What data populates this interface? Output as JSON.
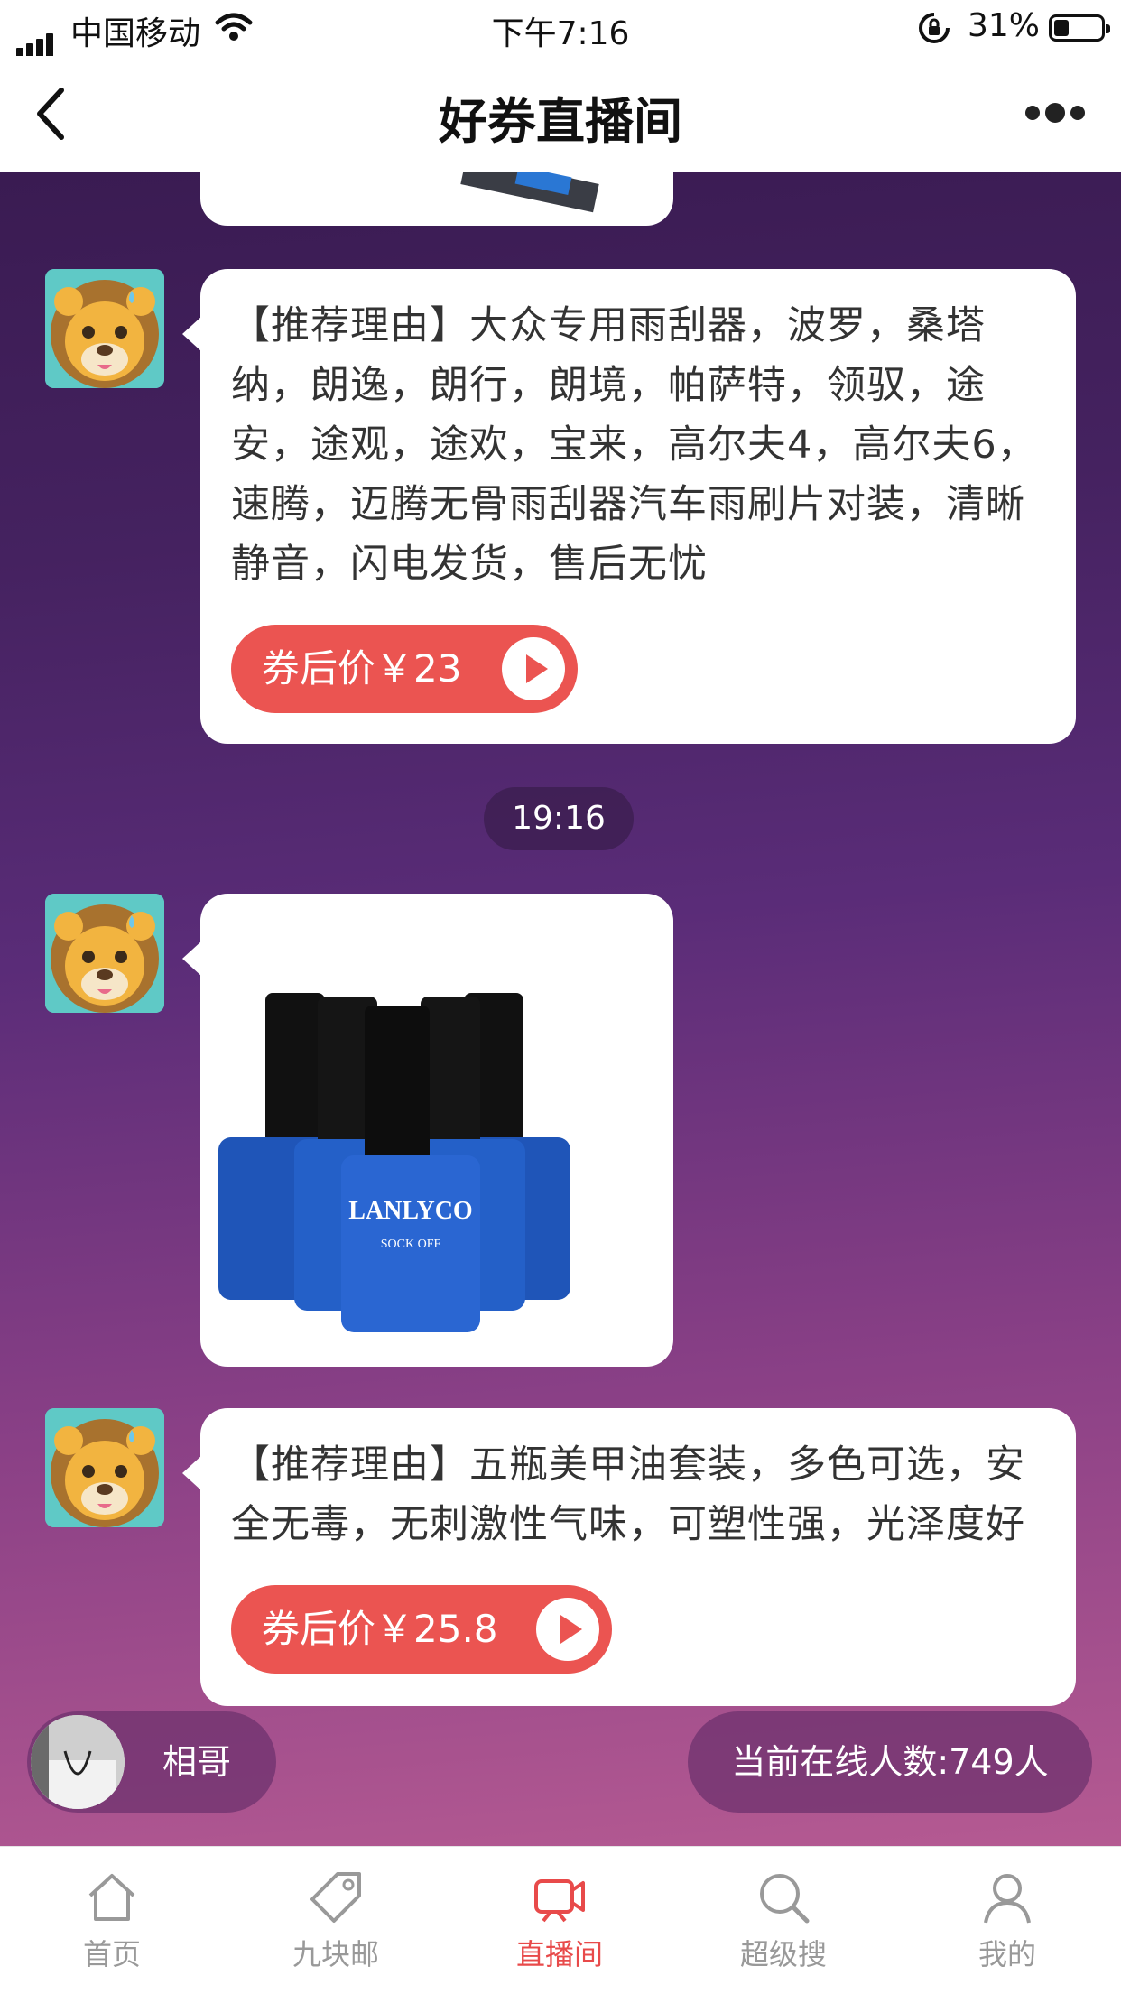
{
  "status_bar": {
    "carrier": "中国移动",
    "time": "下午7:16",
    "battery_pct": "31%",
    "battery_level": 0.31
  },
  "nav": {
    "title": "好券直播间"
  },
  "messages": [
    {
      "type": "text",
      "text": "【推荐理由】大众专用雨刮器，波罗，桑塔纳，朗逸，朗行，朗境，帕萨特，领驭，途安，途观，途欢，宝来，高尔夫4，高尔夫6，速腾，迈腾无骨雨刮器汽车雨刷片对装，清晰静音，闪电发货，售后无忧",
      "price_label": "券后价￥23"
    },
    {
      "type": "timestamp",
      "text": "19:16"
    },
    {
      "type": "image",
      "product_brand": "LANLYCO",
      "product_sub": "SOCK OFF"
    },
    {
      "type": "text",
      "text": "【推荐理由】五瓶美甲油套装，多色可选，安全无毒，无刺激性气味，可塑性强，光泽度好",
      "price_label": "券后价￥25.8"
    }
  ],
  "anchor": {
    "name": "相哥"
  },
  "online": {
    "label": "当前在线人数:749人"
  },
  "tabs": [
    {
      "label": "首页",
      "icon": "home-icon",
      "active": false
    },
    {
      "label": "九块邮",
      "icon": "tag-icon",
      "active": false
    },
    {
      "label": "直播间",
      "icon": "live-icon",
      "active": true
    },
    {
      "label": "超级搜",
      "icon": "search-icon",
      "active": false
    },
    {
      "label": "我的",
      "icon": "user-icon",
      "active": false
    }
  ],
  "colors": {
    "accent": "#eb5451",
    "tab_active": "#e84a4a",
    "tab_inactive": "#999999",
    "product_bottle": "#1f55b8"
  }
}
